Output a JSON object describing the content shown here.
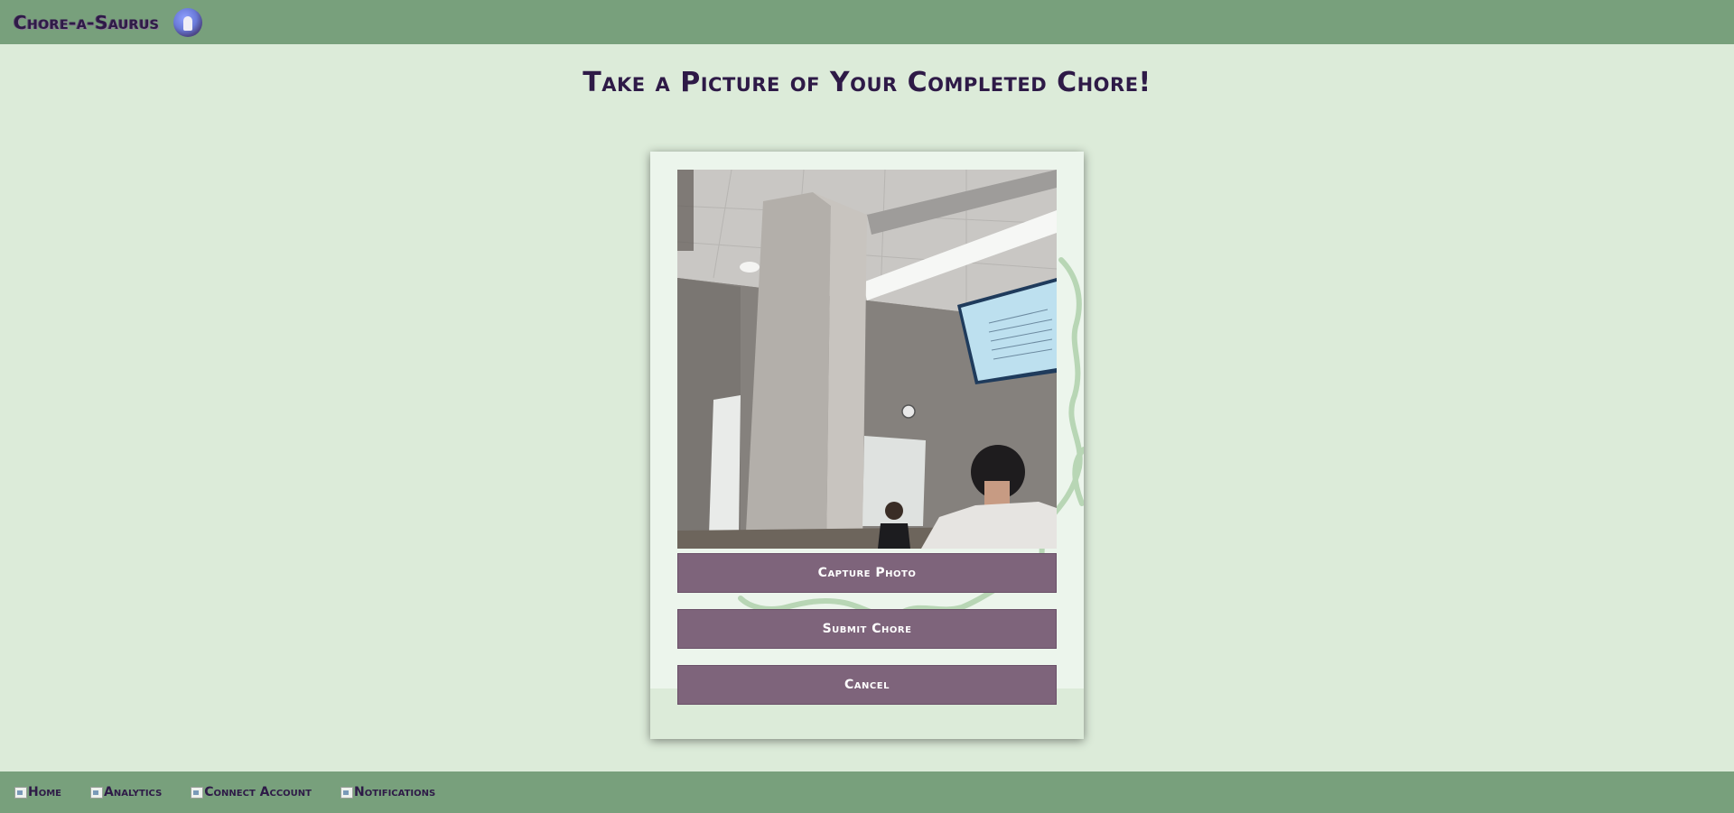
{
  "header": {
    "brand": "Chore-a-Saurus",
    "avatar_icon": "dinosaur-logo-icon"
  },
  "main": {
    "title": "Take a Picture of Your Completed Chore!"
  },
  "camera": {
    "preview_icon": "camera-preview-image"
  },
  "buttons": {
    "capture": "Capture Photo",
    "submit": "Submit Chore",
    "cancel": "Cancel"
  },
  "nav": {
    "items": [
      {
        "label": "Home",
        "icon": "home-icon"
      },
      {
        "label": "Analytics",
        "icon": "analytics-icon"
      },
      {
        "label": "Connect Account",
        "icon": "connect-account-icon"
      },
      {
        "label": "Notifications",
        "icon": "notifications-icon"
      }
    ]
  },
  "colors": {
    "bar": "#78a07c",
    "background": "#dcebd9",
    "button": "#7e647b",
    "text": "#2e1a47"
  }
}
